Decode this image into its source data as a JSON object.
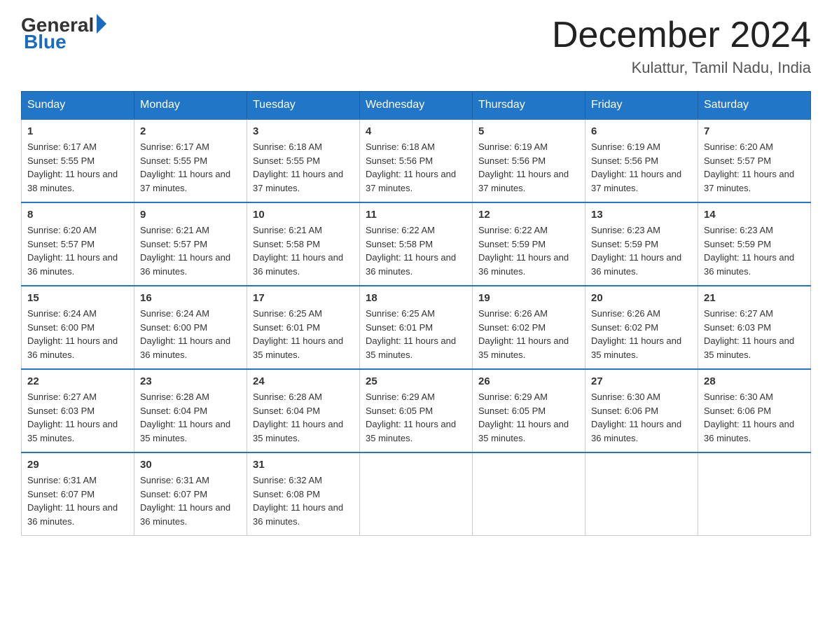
{
  "header": {
    "logo_text1": "General",
    "logo_text2": "Blue",
    "month": "December 2024",
    "location": "Kulattur, Tamil Nadu, India"
  },
  "weekdays": [
    "Sunday",
    "Monday",
    "Tuesday",
    "Wednesday",
    "Thursday",
    "Friday",
    "Saturday"
  ],
  "weeks": [
    [
      {
        "day": "1",
        "sunrise": "Sunrise: 6:17 AM",
        "sunset": "Sunset: 5:55 PM",
        "daylight": "Daylight: 11 hours and 38 minutes."
      },
      {
        "day": "2",
        "sunrise": "Sunrise: 6:17 AM",
        "sunset": "Sunset: 5:55 PM",
        "daylight": "Daylight: 11 hours and 37 minutes."
      },
      {
        "day": "3",
        "sunrise": "Sunrise: 6:18 AM",
        "sunset": "Sunset: 5:55 PM",
        "daylight": "Daylight: 11 hours and 37 minutes."
      },
      {
        "day": "4",
        "sunrise": "Sunrise: 6:18 AM",
        "sunset": "Sunset: 5:56 PM",
        "daylight": "Daylight: 11 hours and 37 minutes."
      },
      {
        "day": "5",
        "sunrise": "Sunrise: 6:19 AM",
        "sunset": "Sunset: 5:56 PM",
        "daylight": "Daylight: 11 hours and 37 minutes."
      },
      {
        "day": "6",
        "sunrise": "Sunrise: 6:19 AM",
        "sunset": "Sunset: 5:56 PM",
        "daylight": "Daylight: 11 hours and 37 minutes."
      },
      {
        "day": "7",
        "sunrise": "Sunrise: 6:20 AM",
        "sunset": "Sunset: 5:57 PM",
        "daylight": "Daylight: 11 hours and 37 minutes."
      }
    ],
    [
      {
        "day": "8",
        "sunrise": "Sunrise: 6:20 AM",
        "sunset": "Sunset: 5:57 PM",
        "daylight": "Daylight: 11 hours and 36 minutes."
      },
      {
        "day": "9",
        "sunrise": "Sunrise: 6:21 AM",
        "sunset": "Sunset: 5:57 PM",
        "daylight": "Daylight: 11 hours and 36 minutes."
      },
      {
        "day": "10",
        "sunrise": "Sunrise: 6:21 AM",
        "sunset": "Sunset: 5:58 PM",
        "daylight": "Daylight: 11 hours and 36 minutes."
      },
      {
        "day": "11",
        "sunrise": "Sunrise: 6:22 AM",
        "sunset": "Sunset: 5:58 PM",
        "daylight": "Daylight: 11 hours and 36 minutes."
      },
      {
        "day": "12",
        "sunrise": "Sunrise: 6:22 AM",
        "sunset": "Sunset: 5:59 PM",
        "daylight": "Daylight: 11 hours and 36 minutes."
      },
      {
        "day": "13",
        "sunrise": "Sunrise: 6:23 AM",
        "sunset": "Sunset: 5:59 PM",
        "daylight": "Daylight: 11 hours and 36 minutes."
      },
      {
        "day": "14",
        "sunrise": "Sunrise: 6:23 AM",
        "sunset": "Sunset: 5:59 PM",
        "daylight": "Daylight: 11 hours and 36 minutes."
      }
    ],
    [
      {
        "day": "15",
        "sunrise": "Sunrise: 6:24 AM",
        "sunset": "Sunset: 6:00 PM",
        "daylight": "Daylight: 11 hours and 36 minutes."
      },
      {
        "day": "16",
        "sunrise": "Sunrise: 6:24 AM",
        "sunset": "Sunset: 6:00 PM",
        "daylight": "Daylight: 11 hours and 36 minutes."
      },
      {
        "day": "17",
        "sunrise": "Sunrise: 6:25 AM",
        "sunset": "Sunset: 6:01 PM",
        "daylight": "Daylight: 11 hours and 35 minutes."
      },
      {
        "day": "18",
        "sunrise": "Sunrise: 6:25 AM",
        "sunset": "Sunset: 6:01 PM",
        "daylight": "Daylight: 11 hours and 35 minutes."
      },
      {
        "day": "19",
        "sunrise": "Sunrise: 6:26 AM",
        "sunset": "Sunset: 6:02 PM",
        "daylight": "Daylight: 11 hours and 35 minutes."
      },
      {
        "day": "20",
        "sunrise": "Sunrise: 6:26 AM",
        "sunset": "Sunset: 6:02 PM",
        "daylight": "Daylight: 11 hours and 35 minutes."
      },
      {
        "day": "21",
        "sunrise": "Sunrise: 6:27 AM",
        "sunset": "Sunset: 6:03 PM",
        "daylight": "Daylight: 11 hours and 35 minutes."
      }
    ],
    [
      {
        "day": "22",
        "sunrise": "Sunrise: 6:27 AM",
        "sunset": "Sunset: 6:03 PM",
        "daylight": "Daylight: 11 hours and 35 minutes."
      },
      {
        "day": "23",
        "sunrise": "Sunrise: 6:28 AM",
        "sunset": "Sunset: 6:04 PM",
        "daylight": "Daylight: 11 hours and 35 minutes."
      },
      {
        "day": "24",
        "sunrise": "Sunrise: 6:28 AM",
        "sunset": "Sunset: 6:04 PM",
        "daylight": "Daylight: 11 hours and 35 minutes."
      },
      {
        "day": "25",
        "sunrise": "Sunrise: 6:29 AM",
        "sunset": "Sunset: 6:05 PM",
        "daylight": "Daylight: 11 hours and 35 minutes."
      },
      {
        "day": "26",
        "sunrise": "Sunrise: 6:29 AM",
        "sunset": "Sunset: 6:05 PM",
        "daylight": "Daylight: 11 hours and 35 minutes."
      },
      {
        "day": "27",
        "sunrise": "Sunrise: 6:30 AM",
        "sunset": "Sunset: 6:06 PM",
        "daylight": "Daylight: 11 hours and 36 minutes."
      },
      {
        "day": "28",
        "sunrise": "Sunrise: 6:30 AM",
        "sunset": "Sunset: 6:06 PM",
        "daylight": "Daylight: 11 hours and 36 minutes."
      }
    ],
    [
      {
        "day": "29",
        "sunrise": "Sunrise: 6:31 AM",
        "sunset": "Sunset: 6:07 PM",
        "daylight": "Daylight: 11 hours and 36 minutes."
      },
      {
        "day": "30",
        "sunrise": "Sunrise: 6:31 AM",
        "sunset": "Sunset: 6:07 PM",
        "daylight": "Daylight: 11 hours and 36 minutes."
      },
      {
        "day": "31",
        "sunrise": "Sunrise: 6:32 AM",
        "sunset": "Sunset: 6:08 PM",
        "daylight": "Daylight: 11 hours and 36 minutes."
      },
      null,
      null,
      null,
      null
    ]
  ]
}
